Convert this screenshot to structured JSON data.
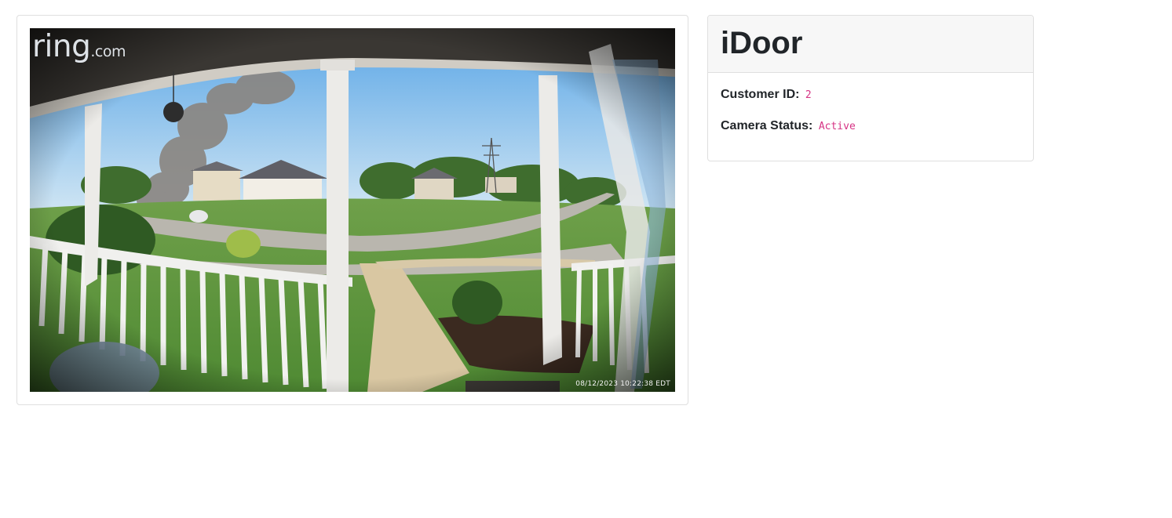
{
  "camera": {
    "watermark_main": "ring",
    "watermark_suffix": ".com",
    "timestamp": "08/12/2023 10:22:38 EDT"
  },
  "info": {
    "title": "iDoor",
    "customer_id_label": "Customer ID:",
    "customer_id_value": "2",
    "camera_status_label": "Camera Status:",
    "camera_status_value": "Active"
  },
  "colors": {
    "code_pink": "#d63384",
    "header_bg": "#f7f7f7",
    "border": "#dfdfdf"
  }
}
